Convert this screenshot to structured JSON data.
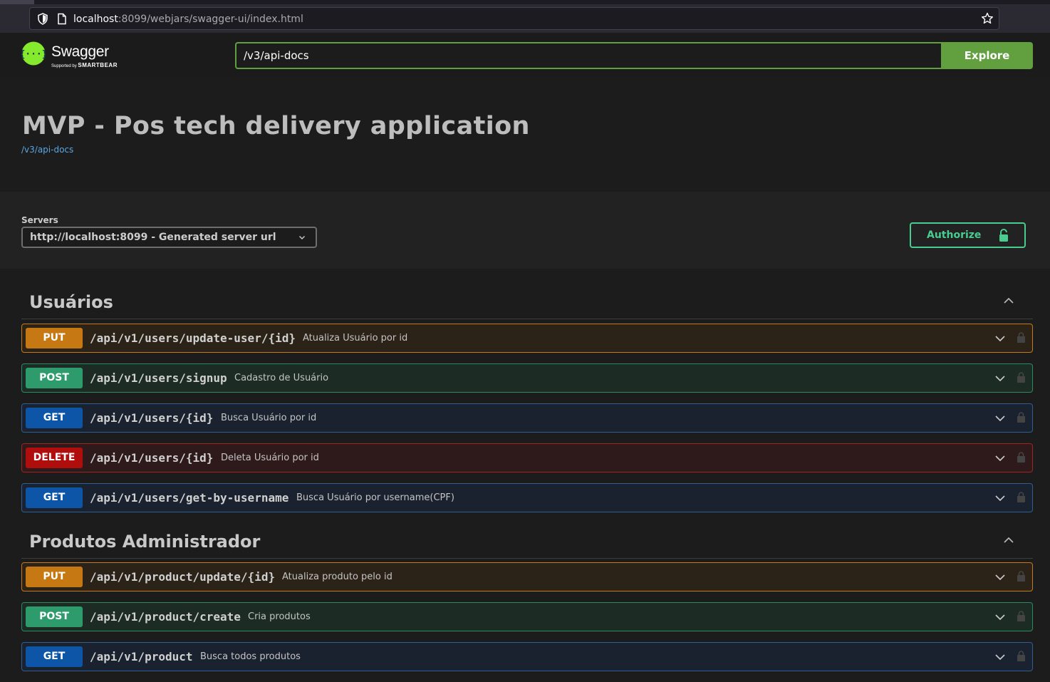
{
  "browser": {
    "url_host": "localhost",
    "url_rest": ":8099/webjars/swagger-ui/index.html",
    "icons": [
      "shield-icon",
      "page-icon",
      "star-icon"
    ]
  },
  "topbar": {
    "logo_text": "Swagger",
    "logo_sub_small": "Supported by ",
    "logo_sub_brand": "SMARTBEAR",
    "spec_url": "/v3/api-docs",
    "explore_label": "Explore",
    "accent_color": "#62a03f"
  },
  "info": {
    "title": "MVP - Pos tech delivery application",
    "spec_link": "/v3/api-docs"
  },
  "servers": {
    "label": "Servers",
    "selected": "http://localhost:8099 - Generated server url",
    "authorize_label": "Authorize"
  },
  "tags": [
    {
      "name": "Usuários",
      "operations": [
        {
          "method": "PUT",
          "path": "/api/v1/users/update-user/{id}",
          "summary": "Atualiza Usuário por id"
        },
        {
          "method": "POST",
          "path": "/api/v1/users/signup",
          "summary": "Cadastro de Usuário"
        },
        {
          "method": "GET",
          "path": "/api/v1/users/{id}",
          "summary": "Busca Usuário por id"
        },
        {
          "method": "DELETE",
          "path": "/api/v1/users/{id}",
          "summary": "Deleta Usuário por id"
        },
        {
          "method": "GET",
          "path": "/api/v1/users/get-by-username",
          "summary": "Busca Usuário por username(CPF)"
        }
      ]
    },
    {
      "name": "Produtos Administrador",
      "operations": [
        {
          "method": "PUT",
          "path": "/api/v1/product/update/{id}",
          "summary": "Atualiza produto pelo id"
        },
        {
          "method": "POST",
          "path": "/api/v1/product/create",
          "summary": "Cria produtos"
        },
        {
          "method": "GET",
          "path": "/api/v1/product",
          "summary": "Busca todos produtos"
        }
      ]
    }
  ],
  "colors": {
    "put": "#c67812",
    "post": "#2e9b6c",
    "get": "#0d55a6",
    "delete": "#b00d0d",
    "authorize": "#49cc90"
  }
}
